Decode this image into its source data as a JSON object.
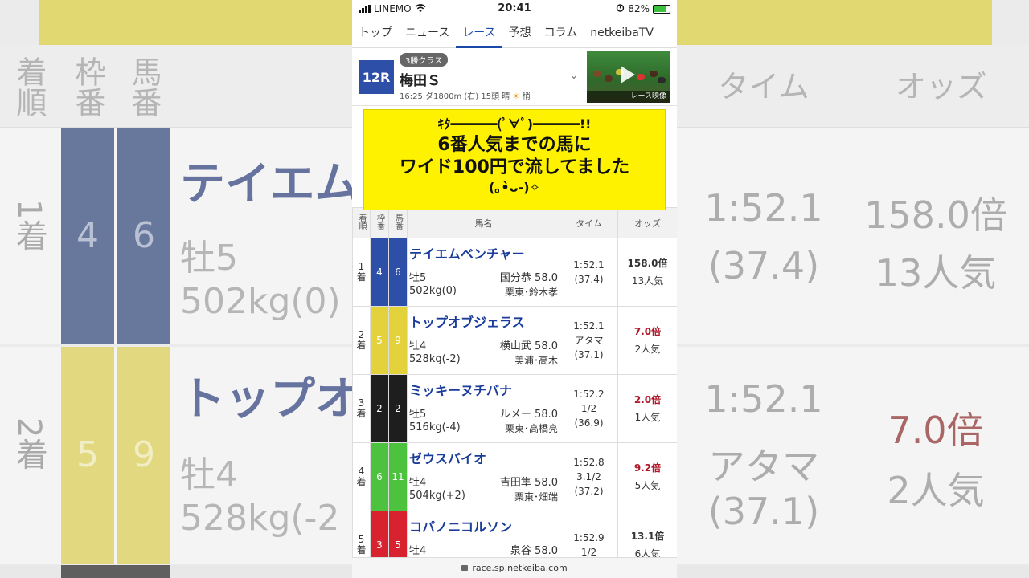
{
  "status_bar": {
    "carrier": "LINEMO",
    "time": "20:41",
    "battery": "82%"
  },
  "nav": {
    "tabs": [
      "トップ",
      "ニュース",
      "レース",
      "予想",
      "コラム",
      "netkeibaTV"
    ],
    "active": "レース"
  },
  "race": {
    "number": "12R",
    "class": "3勝クラス",
    "name": "梅田Ｓ",
    "meta_time": "16:25",
    "meta_course": "ダ1800m (右)",
    "meta_runners": "15頭",
    "meta_weather": "晴",
    "meta_going": "稍",
    "video_label": "レース映像"
  },
  "overlay": {
    "line1": "ｷﾀ━━━━━━(ﾟ∀ﾟ)━━━━━━!!",
    "line2": "6番人気までの馬に",
    "line3": "ワイド100円で流してました",
    "line4": "(｡•̀ᴗ-)✧"
  },
  "table": {
    "headers": {
      "rank": "着順",
      "frame": "枠番",
      "num": "馬番",
      "name": "馬名",
      "time": "タイム",
      "odds": "オッズ"
    },
    "rows": [
      {
        "rank": "1",
        "rank_unit": "着",
        "frame": "4",
        "num": "6",
        "name": "テイエムベンチャー",
        "sex_age": "牡5",
        "jockey_weight": "国分恭 58.0",
        "body_weight": "502kg(0)",
        "trainer": "栗東･鈴木孝",
        "time": "1:52.1",
        "margin": "",
        "last3f": "(37.4)",
        "odds": "158.0倍",
        "pop": "13人気",
        "odds_red": false
      },
      {
        "rank": "2",
        "rank_unit": "着",
        "frame": "5",
        "num": "9",
        "name": "トップオブジェラス",
        "sex_age": "牡4",
        "jockey_weight": "横山武 58.0",
        "body_weight": "528kg(-2)",
        "trainer": "美浦･高木",
        "time": "1:52.1",
        "margin": "アタマ",
        "last3f": "(37.1)",
        "odds": "7.0倍",
        "pop": "2人気",
        "odds_red": true
      },
      {
        "rank": "3",
        "rank_unit": "着",
        "frame": "2",
        "num": "2",
        "name": "ミッキーヌチバナ",
        "sex_age": "牡5",
        "jockey_weight": "ルメー 58.0",
        "body_weight": "516kg(-4)",
        "trainer": "栗東･高橋亮",
        "time": "1:52.2",
        "margin": "1/2",
        "last3f": "(36.9)",
        "odds": "2.0倍",
        "pop": "1人気",
        "odds_red": true
      },
      {
        "rank": "4",
        "rank_unit": "着",
        "frame": "6",
        "num": "11",
        "name": "ゼウスバイオ",
        "sex_age": "牡4",
        "jockey_weight": "吉田隼 58.0",
        "body_weight": "504kg(+2)",
        "trainer": "栗東･畑端",
        "time": "1:52.8",
        "margin": "3.1/2",
        "last3f": "(37.2)",
        "odds": "9.2倍",
        "pop": "5人気",
        "odds_red": true
      },
      {
        "rank": "5",
        "rank_unit": "着",
        "frame": "3",
        "num": "5",
        "name": "コパノニコルソン",
        "sex_age": "牡4",
        "jockey_weight": "泉谷 58.0",
        "body_weight": "",
        "trainer": "",
        "time": "1:52.9",
        "margin": "1/2",
        "last3f": "",
        "odds": "13.1倍",
        "pop": "6人気",
        "odds_red": false
      }
    ]
  },
  "url": "race.sp.netkeiba.com",
  "colors": {
    "frame_4": "#2e4fa8",
    "frame_5": "#e4d23c",
    "frame_2": "#1e1e1e",
    "frame_6": "#4cc23f",
    "frame_3": "#d8222f",
    "odds_red": "#b0182a",
    "accent": "#1a4aa8",
    "overlay": "#fff200"
  },
  "background": {
    "headers": {
      "rank": "着順",
      "frame": "枠番",
      "num": "馬番",
      "time": "タイム",
      "odds": "オッズ"
    },
    "rows": [
      {
        "rank": "1着",
        "frame": "4",
        "num": "6",
        "name": "テイエム",
        "sub1": "牡5",
        "sub2": "502kg(0)",
        "time": "1:52.1",
        "time2": "(37.4)",
        "odds": "158.0倍",
        "pop": "13人気"
      },
      {
        "rank": "2着",
        "frame": "5",
        "num": "9",
        "name": "トップオ",
        "sub1": "牡4",
        "sub2": "528kg(-2",
        "time": "1:52.1",
        "time2": "アタマ",
        "time3": "(37.1)",
        "odds": "7.0倍",
        "pop": "2人気"
      }
    ]
  }
}
